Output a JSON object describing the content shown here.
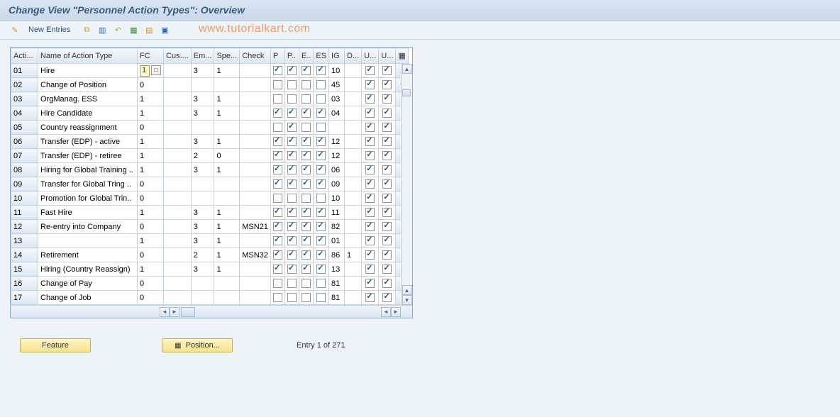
{
  "header": {
    "title": "Change View \"Personnel Action Types\": Overview"
  },
  "toolbar": {
    "new_entries": "New Entries"
  },
  "watermark": "www.tutorialkart.com",
  "columns": {
    "acti": "Acti...",
    "name": "Name of Action Type",
    "fc": "FC",
    "cus": "Cus....",
    "em": "Em...",
    "spe": "Spe...",
    "check": "Check",
    "p1": "P",
    "p2": "P..",
    "e": "E..",
    "es": "ES",
    "ig": "IG",
    "d": "D...",
    "u1": "U...",
    "u2": "U..."
  },
  "rows": [
    {
      "acti": "01",
      "name": "Hire",
      "fc": "1",
      "cus": "",
      "em": "3",
      "spe": "1",
      "check": "",
      "p1": true,
      "p2": true,
      "e": true,
      "es": true,
      "ig": "10",
      "d": "",
      "u1": true,
      "u2": true,
      "fc_input": true
    },
    {
      "acti": "02",
      "name": "Change of Position",
      "fc": "0",
      "cus": "",
      "em": "",
      "spe": "",
      "check": "",
      "p1": false,
      "p2": false,
      "e": false,
      "es": false,
      "ig": "45",
      "d": "",
      "u1": true,
      "u2": true
    },
    {
      "acti": "03",
      "name": "OrgManag. ESS",
      "fc": "1",
      "cus": "",
      "em": "3",
      "spe": "1",
      "check": "",
      "p1": false,
      "p2": false,
      "e": false,
      "es": false,
      "ig": "03",
      "d": "",
      "u1": true,
      "u2": true
    },
    {
      "acti": "04",
      "name": "Hire Candidate",
      "fc": "1",
      "cus": "",
      "em": "3",
      "spe": "1",
      "check": "",
      "p1": true,
      "p2": true,
      "e": true,
      "es": true,
      "ig": "04",
      "d": "",
      "u1": true,
      "u2": true
    },
    {
      "acti": "05",
      "name": "Country reassignment",
      "fc": "0",
      "cus": "",
      "em": "",
      "spe": "",
      "check": "",
      "p1": false,
      "p2": true,
      "e": false,
      "es": false,
      "ig": "",
      "d": "",
      "u1": true,
      "u2": true
    },
    {
      "acti": "06",
      "name": "Transfer (EDP) - active",
      "fc": "1",
      "cus": "",
      "em": "3",
      "spe": "1",
      "check": "",
      "p1": true,
      "p2": true,
      "e": true,
      "es": true,
      "ig": "12",
      "d": "",
      "u1": true,
      "u2": true
    },
    {
      "acti": "07",
      "name": "Transfer (EDP) - retiree",
      "fc": "1",
      "cus": "",
      "em": "2",
      "spe": "0",
      "check": "",
      "p1": true,
      "p2": true,
      "e": true,
      "es": true,
      "ig": "12",
      "d": "",
      "u1": true,
      "u2": true
    },
    {
      "acti": "08",
      "name": "Hiring for Global Training ..",
      "fc": "1",
      "cus": "",
      "em": "3",
      "spe": "1",
      "check": "",
      "p1": true,
      "p2": true,
      "e": true,
      "es": true,
      "ig": "06",
      "d": "",
      "u1": true,
      "u2": true
    },
    {
      "acti": "09",
      "name": "Transfer for Global Tring ..",
      "fc": "0",
      "cus": "",
      "em": "",
      "spe": "",
      "check": "",
      "p1": true,
      "p2": true,
      "e": true,
      "es": true,
      "ig": "09",
      "d": "",
      "u1": true,
      "u2": true
    },
    {
      "acti": "10",
      "name": "Promotion for Global Trin..",
      "fc": "0",
      "cus": "",
      "em": "",
      "spe": "",
      "check": "",
      "p1": false,
      "p2": false,
      "e": false,
      "es": false,
      "ig": "10",
      "d": "",
      "u1": true,
      "u2": true
    },
    {
      "acti": "11",
      "name": "Fast Hire",
      "fc": "1",
      "cus": "",
      "em": "3",
      "spe": "1",
      "check": "",
      "p1": true,
      "p2": true,
      "e": true,
      "es": true,
      "ig": "11",
      "d": "",
      "u1": true,
      "u2": true
    },
    {
      "acti": "12",
      "name": "Re-entry into Company",
      "fc": "0",
      "cus": "",
      "em": "3",
      "spe": "1",
      "check": "MSN21",
      "p1": true,
      "p2": true,
      "e": true,
      "es": true,
      "ig": "82",
      "d": "",
      "u1": true,
      "u2": true
    },
    {
      "acti": "13",
      "name": "",
      "fc": "1",
      "cus": "",
      "em": "3",
      "spe": "1",
      "check": "",
      "p1": true,
      "p2": true,
      "e": true,
      "es": true,
      "ig": "01",
      "d": "",
      "u1": true,
      "u2": true
    },
    {
      "acti": "14",
      "name": "Retirement",
      "fc": "0",
      "cus": "",
      "em": "2",
      "spe": "1",
      "check": "MSN32",
      "p1": true,
      "p2": true,
      "e": true,
      "es": true,
      "ig": "86",
      "d": "1",
      "u1": true,
      "u2": true
    },
    {
      "acti": "15",
      "name": "Hiring (Country Reassign)",
      "fc": "1",
      "cus": "",
      "em": "3",
      "spe": "1",
      "check": "",
      "p1": true,
      "p2": true,
      "e": true,
      "es": true,
      "ig": "13",
      "d": "",
      "u1": true,
      "u2": true
    },
    {
      "acti": "16",
      "name": "Change of Pay",
      "fc": "0",
      "cus": "",
      "em": "",
      "spe": "",
      "check": "",
      "p1": false,
      "p2": false,
      "e": false,
      "es": false,
      "ig": "81",
      "d": "",
      "u1": true,
      "u2": true
    },
    {
      "acti": "17",
      "name": "Change of Job",
      "fc": "0",
      "cus": "",
      "em": "",
      "spe": "",
      "check": "",
      "p1": false,
      "p2": false,
      "e": false,
      "es": false,
      "ig": "81",
      "d": "",
      "u1": true,
      "u2": true
    }
  ],
  "footer": {
    "feature_btn": "Feature",
    "position_btn": "Position...",
    "entry_label": "Entry 1 of 271"
  }
}
